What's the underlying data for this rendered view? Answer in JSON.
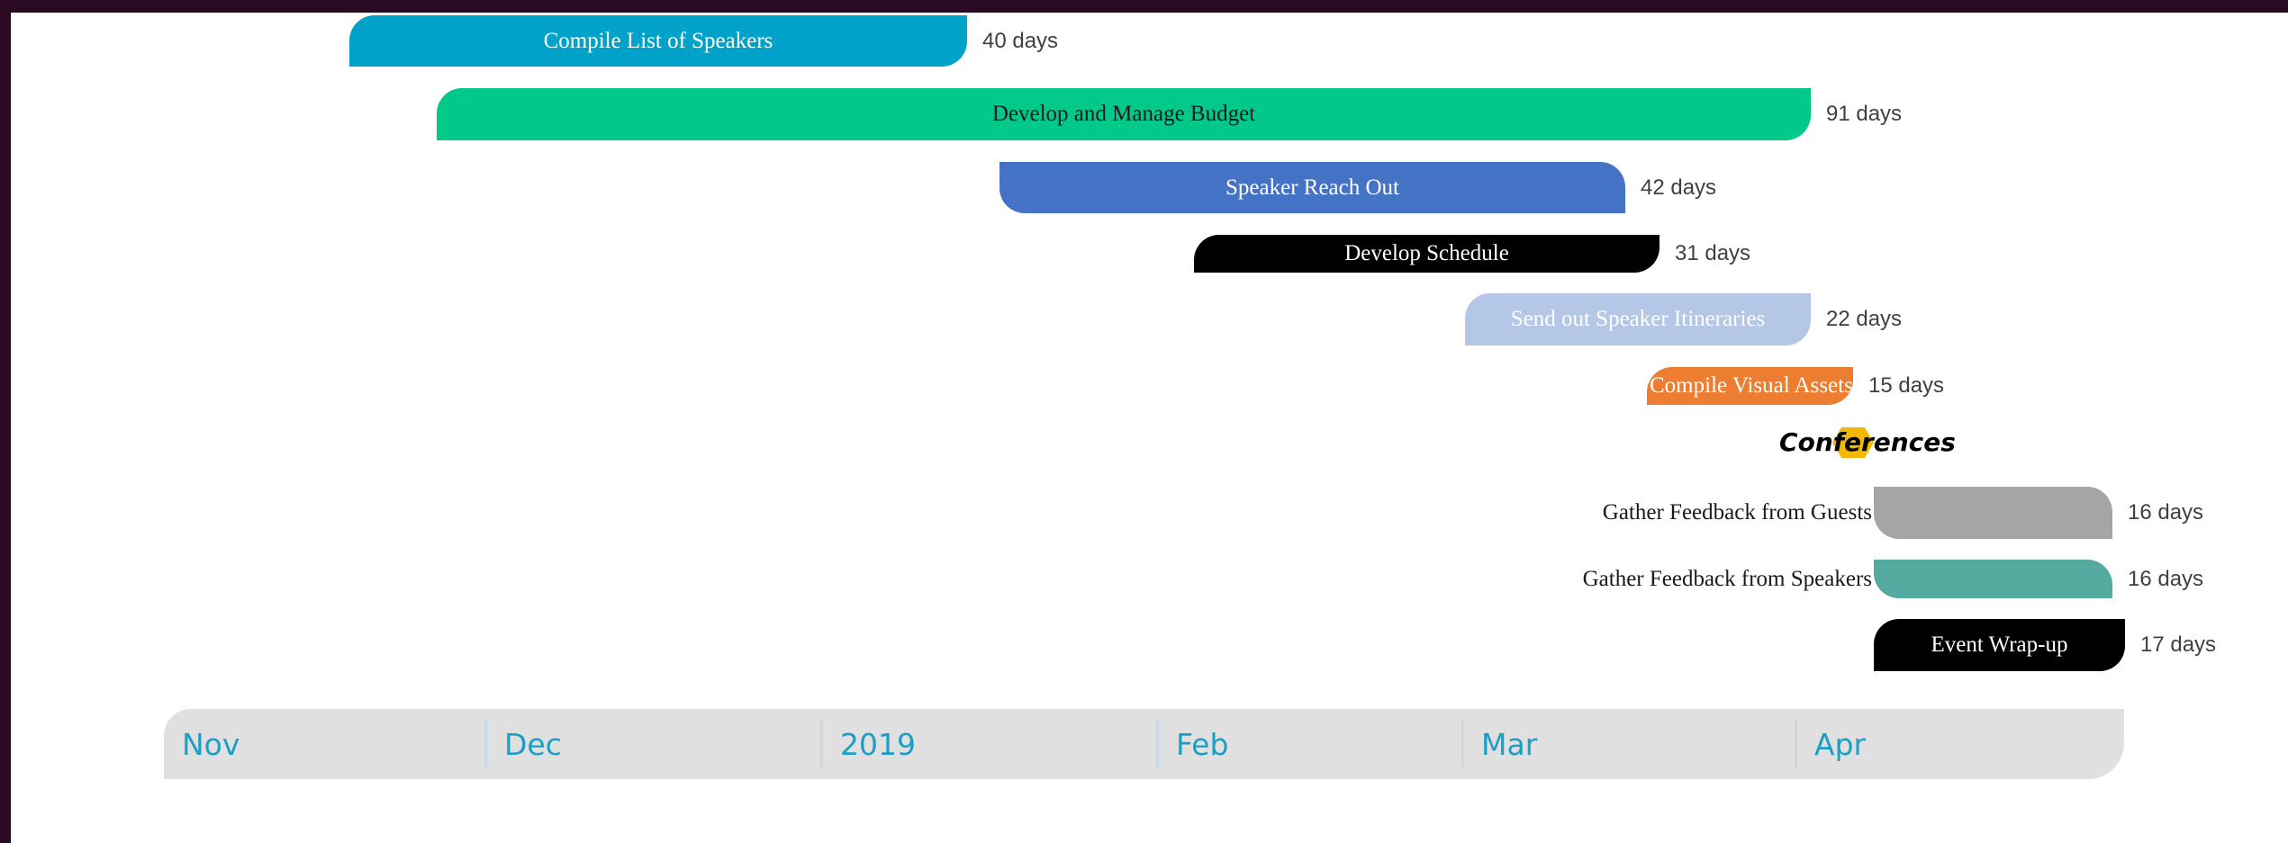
{
  "chart_data": {
    "type": "gantt",
    "axis": {
      "months": [
        "Nov",
        "Dec",
        "2019",
        "Feb",
        "Mar",
        "Apr"
      ]
    },
    "tasks": [
      {
        "name": "Compile List of Speakers",
        "duration": "40 days",
        "color": "#00a2c9",
        "text_color": "#ffffff"
      },
      {
        "name": "Develop and Manage Budget",
        "duration": "91 days",
        "color": "#00c98a",
        "text_color": "#1a1a1a"
      },
      {
        "name": "Speaker Reach Out",
        "duration": "42 days",
        "color": "#4472c4",
        "text_color": "#ffffff"
      },
      {
        "name": "Develop Schedule",
        "duration": "31 days",
        "color": "#000000",
        "text_color": "#ffffff"
      },
      {
        "name": "Send out Speaker Itineraries",
        "duration": "22 days",
        "color": "#b4c7e7",
        "text_color": "#ffffff"
      },
      {
        "name": "Compile Visual Assets",
        "duration": "15 days",
        "color": "#ed7d31",
        "text_color": "#ffffff"
      },
      {
        "name": "Gather Feedback from Guests",
        "duration": "16 days",
        "color": "#a5a5a5",
        "text_color": "#1a1a1a"
      },
      {
        "name": "Gather Feedback from Speakers",
        "duration": "16 days",
        "color": "#55aaa0",
        "text_color": "#1a1a1a"
      },
      {
        "name": "Event Wrap-up",
        "duration": "17 days",
        "color": "#000000",
        "text_color": "#ffffff"
      }
    ],
    "milestones": [
      {
        "name": "Conferences",
        "color": "#f5b800"
      }
    ]
  }
}
